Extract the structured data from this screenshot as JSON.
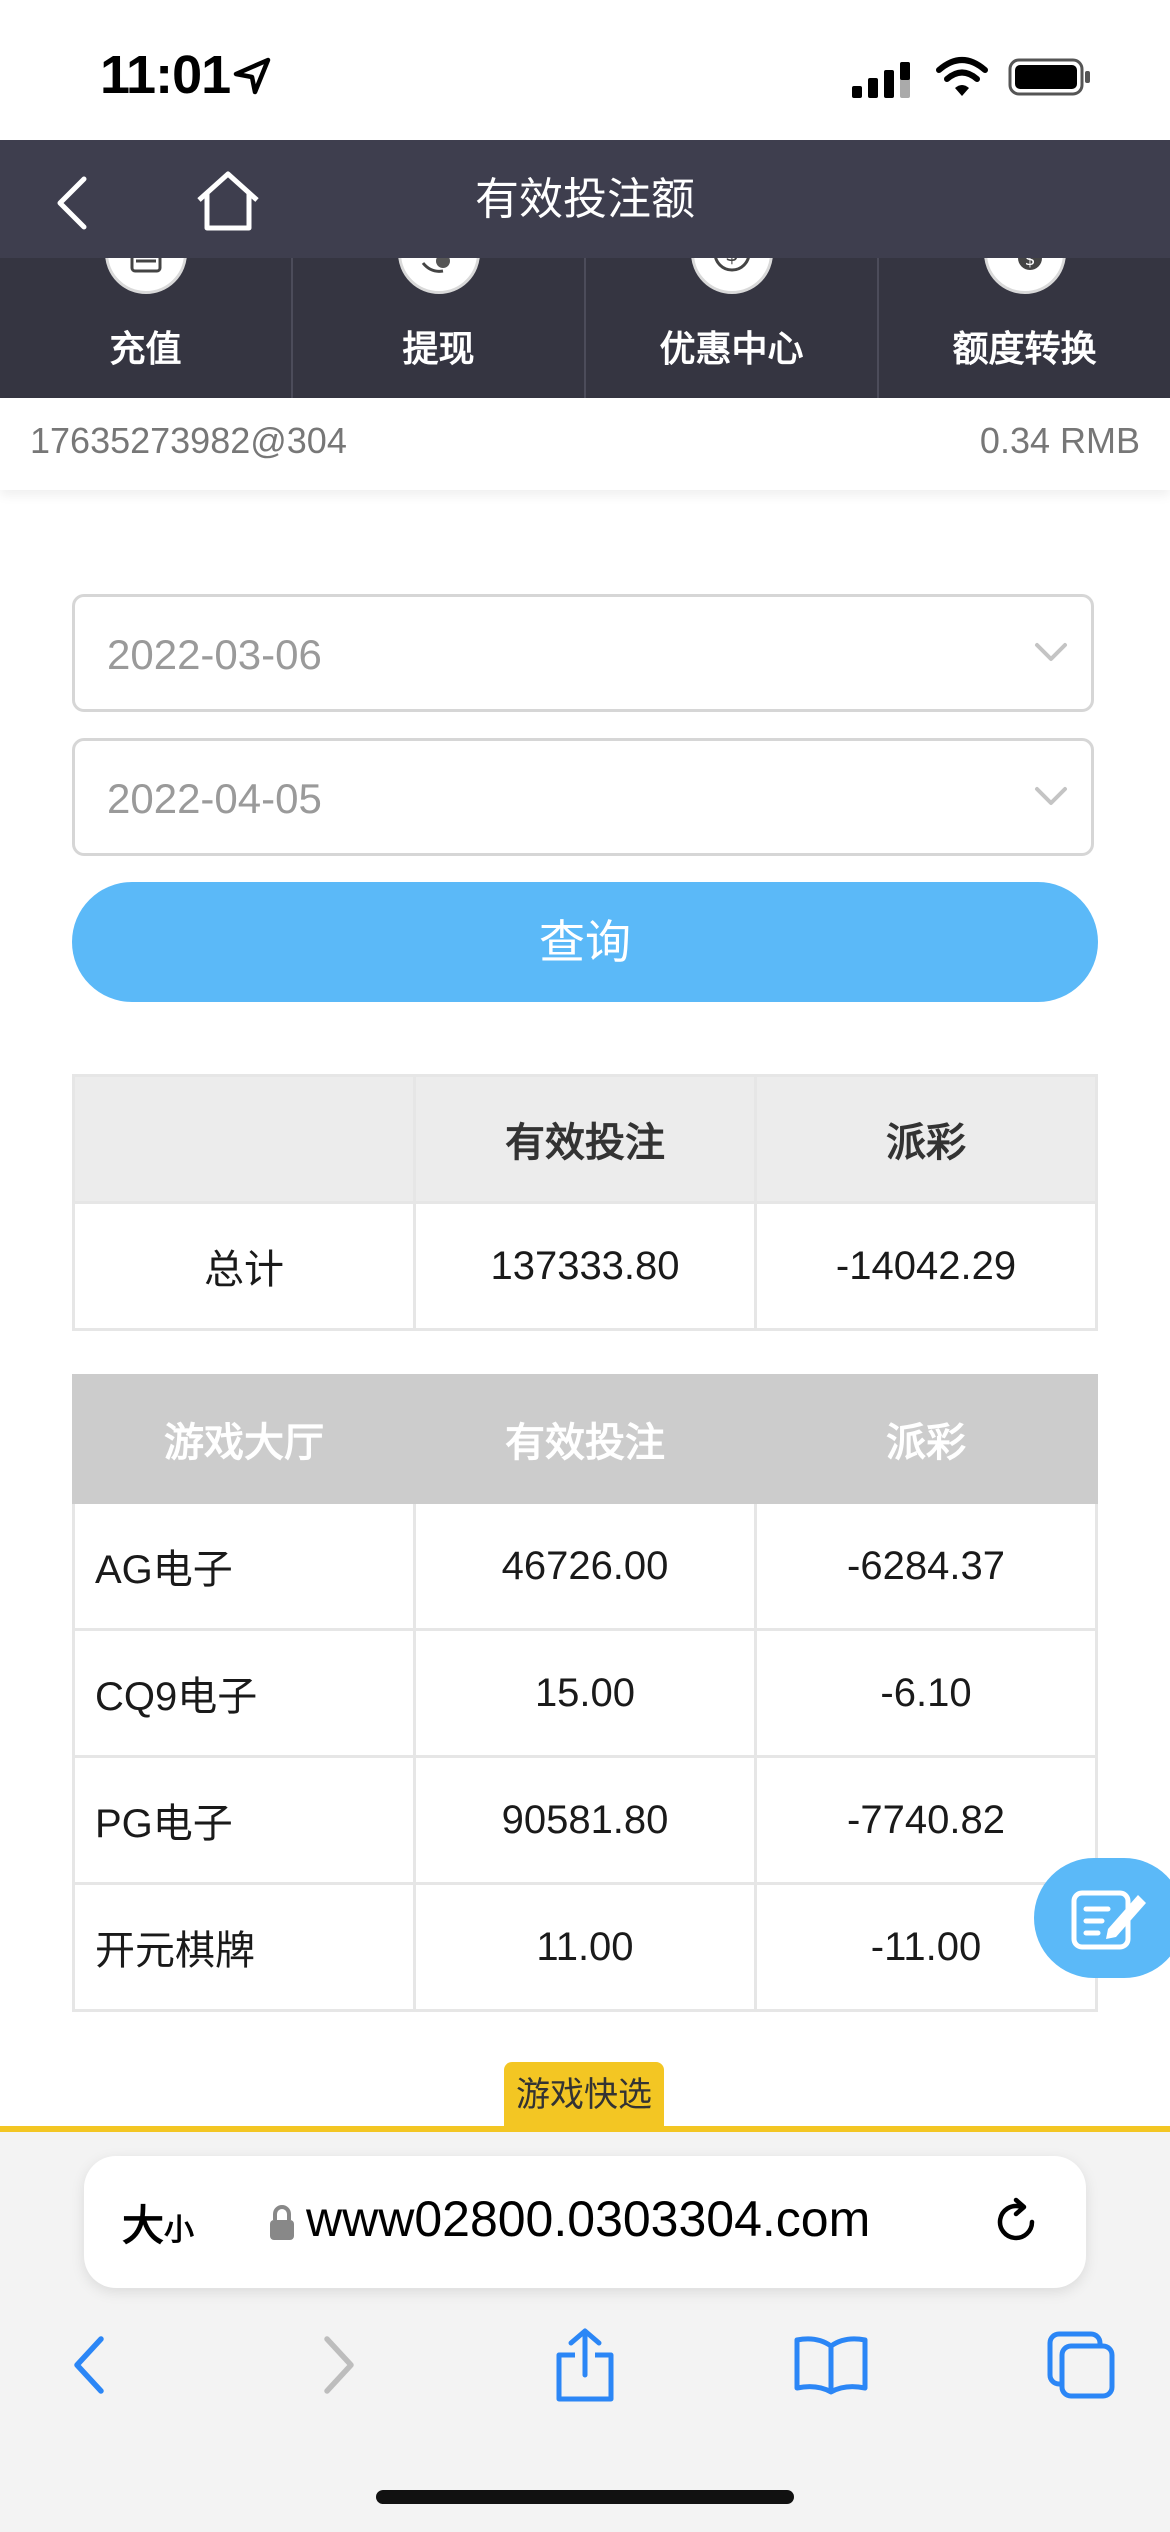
{
  "status_bar": {
    "time": "11:01"
  },
  "header": {
    "title": "有效投注额"
  },
  "quick_actions": [
    {
      "label": "充值",
      "icon": "card-icon"
    },
    {
      "label": "提现",
      "icon": "hand-coin-icon"
    },
    {
      "label": "优惠中心",
      "icon": "dollar-coin-icon"
    },
    {
      "label": "额度转换",
      "icon": "exchange-coin-icon"
    }
  ],
  "account": {
    "id": "17635273982@304",
    "balance": "0.34 RMB"
  },
  "filters": {
    "start_date": "2022-03-06",
    "end_date": "2022-04-05",
    "query_label": "查询"
  },
  "summary_table": {
    "headers": [
      "",
      "有效投注",
      "派彩"
    ],
    "row": {
      "label": "总计",
      "valid_bet": "137333.80",
      "payout": "-14042.29"
    }
  },
  "detail_table": {
    "headers": [
      "游戏大厅",
      "有效投注",
      "派彩"
    ],
    "rows": [
      {
        "hall": "AG电子",
        "valid_bet": "46726.00",
        "payout": "-6284.37"
      },
      {
        "hall": "CQ9电子",
        "valid_bet": "15.00",
        "payout": "-6.10"
      },
      {
        "hall": "PG电子",
        "valid_bet": "90581.80",
        "payout": "-7740.82"
      },
      {
        "hall": "开元棋牌",
        "valid_bet": "11.00",
        "payout": "-11.00"
      }
    ]
  },
  "game_quick_select": "游戏快选",
  "browser": {
    "text_size_big": "大",
    "text_size_small": "小",
    "url": "www02800.0303304.com"
  },
  "colors": {
    "header_bg": "#3e3e4e",
    "accent": "#5bb9f8",
    "highlight": "#f3c623"
  }
}
